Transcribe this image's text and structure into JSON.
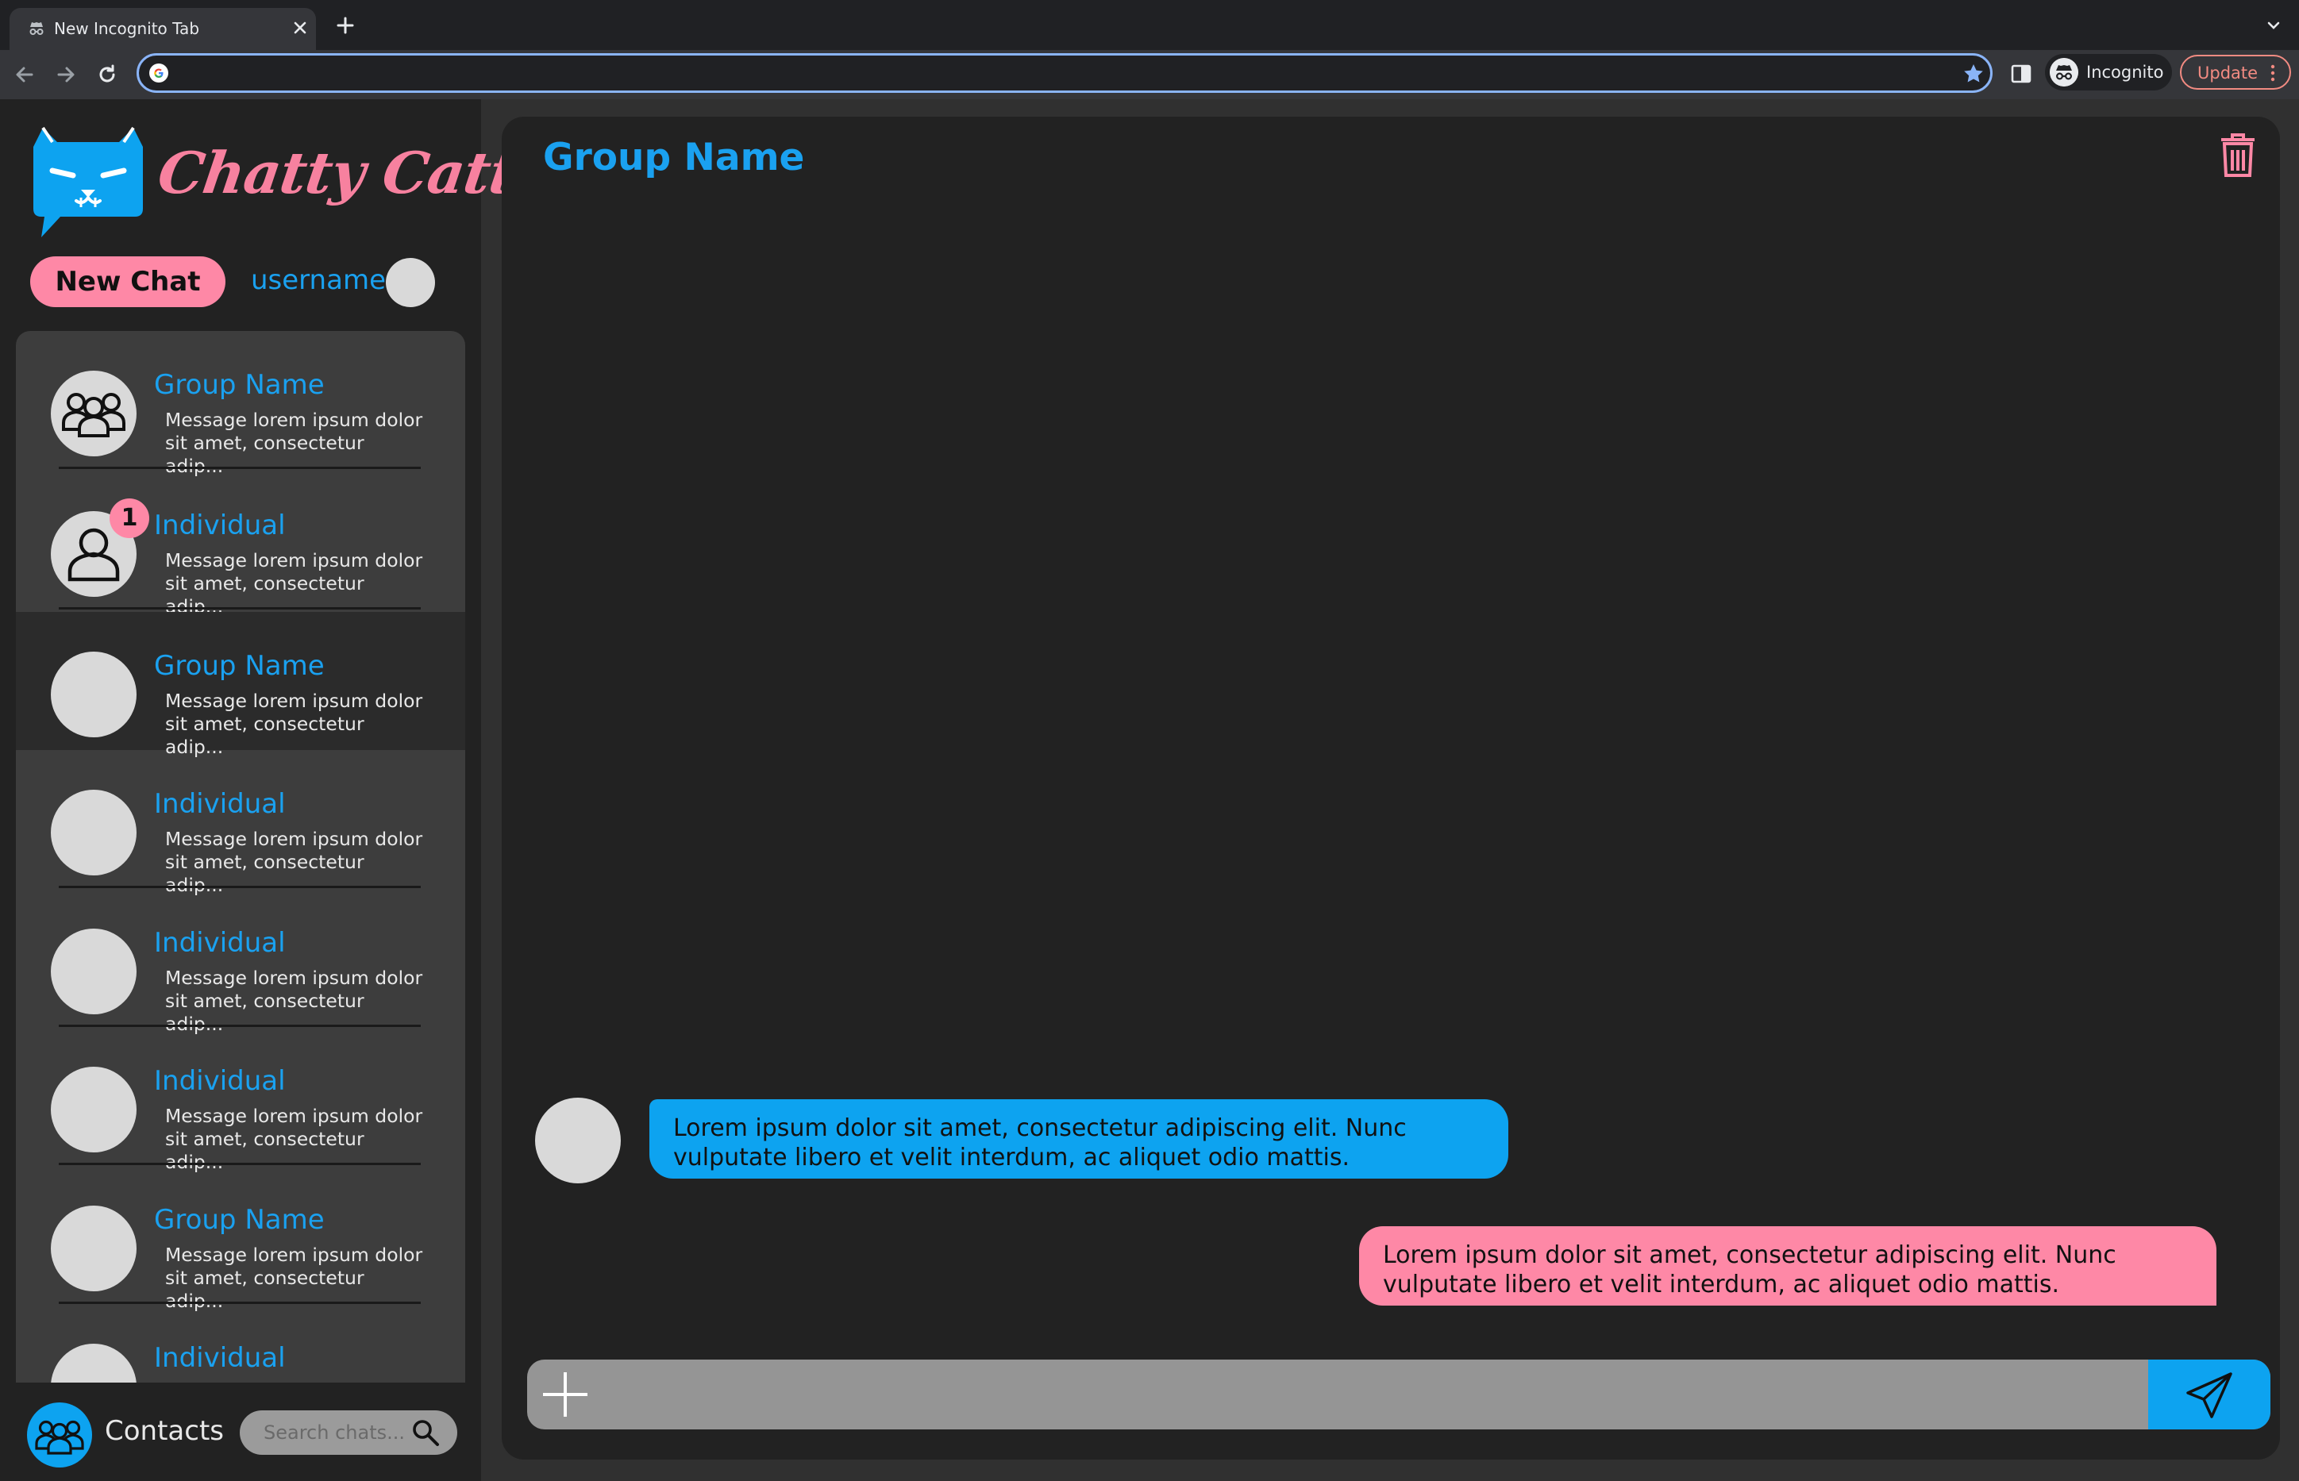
{
  "browser": {
    "tab_title": "New Incognito Tab",
    "address_value": "",
    "incognito_label": "Incognito",
    "update_label": "Update"
  },
  "app": {
    "logo_text": "Chatty Catty",
    "new_chat_label": "New Chat",
    "username": "username",
    "contacts_label": "Contacts",
    "search_placeholder": "Search chats....",
    "chats": [
      {
        "name": "Group Name",
        "preview": "Message lorem ipsum dolor sit amet, consectetur adip...",
        "avatar": "group-icon",
        "unread": ""
      },
      {
        "name": "Individual",
        "preview": "Message lorem ipsum dolor sit amet, consectetur adip...",
        "avatar": "person-icon",
        "unread": "1"
      },
      {
        "name": "Group Name",
        "preview": "Message lorem ipsum dolor sit amet, consectetur adip...",
        "avatar": "blank",
        "unread": ""
      },
      {
        "name": "Individual",
        "preview": "Message lorem ipsum dolor sit amet, consectetur adip...",
        "avatar": "blank",
        "unread": ""
      },
      {
        "name": "Individual",
        "preview": "Message lorem ipsum dolor sit amet, consectetur adip...",
        "avatar": "blank",
        "unread": ""
      },
      {
        "name": "Individual",
        "preview": "Message lorem ipsum dolor sit amet, consectetur adip...",
        "avatar": "blank",
        "unread": ""
      },
      {
        "name": "Group Name",
        "preview": "Message lorem ipsum dolor sit amet, consectetur adip...",
        "avatar": "blank",
        "unread": ""
      },
      {
        "name": "Individual",
        "preview": "",
        "avatar": "blank",
        "unread": ""
      }
    ],
    "conversation": {
      "title": "Group Name",
      "messages": [
        {
          "direction": "incoming",
          "text": "Lorem ipsum dolor sit amet, consectetur adipiscing elit. Nunc vulputate libero et velit interdum, ac aliquet odio mattis."
        },
        {
          "direction": "outgoing",
          "text": "Lorem ipsum dolor sit amet, consectetur adipiscing elit. Nunc vulputate libero et velit interdum, ac aliquet odio mattis."
        }
      ],
      "composer_value": ""
    }
  },
  "colors": {
    "accent_blue": "#0da3f0",
    "accent_pink": "#fe88a6",
    "background": "#303030",
    "panel": "#222222"
  }
}
